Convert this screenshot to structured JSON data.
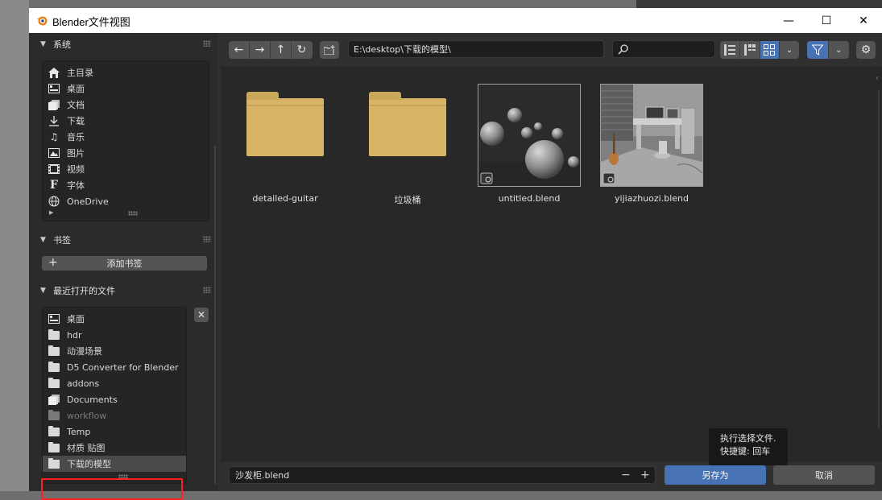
{
  "window": {
    "title": "Blender文件视图",
    "minimize_symbol": "—",
    "maximize_symbol": "☐",
    "close_symbol": "✕"
  },
  "sidebar": {
    "system": {
      "header": "系统",
      "items": [
        {
          "label": "主目录",
          "icon": "home-icon"
        },
        {
          "label": "桌面",
          "icon": "desktop-icon"
        },
        {
          "label": "文档",
          "icon": "documents-icon"
        },
        {
          "label": "下载",
          "icon": "download-icon"
        },
        {
          "label": "音乐",
          "icon": "music-icon"
        },
        {
          "label": "图片",
          "icon": "image-icon"
        },
        {
          "label": "视频",
          "icon": "video-icon"
        },
        {
          "label": "字体",
          "icon": "font-icon"
        },
        {
          "label": "OneDrive",
          "icon": "globe-icon"
        }
      ]
    },
    "bookmarks": {
      "header": "书签",
      "add_label": "添加书签"
    },
    "recent": {
      "header": "最近打开的文件",
      "items": [
        {
          "label": "桌面",
          "icon": "desktop-icon"
        },
        {
          "label": "hdr",
          "icon": "folder-icon"
        },
        {
          "label": "动漫场景",
          "icon": "folder-icon"
        },
        {
          "label": "D5 Converter for Blender",
          "icon": "folder-icon"
        },
        {
          "label": "addons",
          "icon": "folder-icon"
        },
        {
          "label": "Documents",
          "icon": "documents-icon"
        },
        {
          "label": "workflow",
          "icon": "folder-icon"
        },
        {
          "label": "Temp",
          "icon": "folder-icon"
        },
        {
          "label": "材质 贴图",
          "icon": "folder-icon"
        },
        {
          "label": "下载的模型",
          "icon": "folder-icon"
        }
      ]
    }
  },
  "toolbar": {
    "back": "←",
    "forward": "→",
    "parent": "↑",
    "refresh": "↻",
    "path": "E:\\desktop\\下载的模型\\",
    "search_value": ""
  },
  "files": [
    {
      "name": "detailed-guitar",
      "type": "folder"
    },
    {
      "name": "垃圾桶",
      "type": "folder"
    },
    {
      "name": "untitled.blend",
      "type": "blend"
    },
    {
      "name": "yijiazhuozi.blend",
      "type": "blend"
    }
  ],
  "bottom": {
    "filename": "沙发柜.blend",
    "minus": "−",
    "plus": "+",
    "save_label": "另存为",
    "cancel_label": "取消"
  },
  "tooltip": {
    "line1": "执行选择文件.",
    "line2": "快捷键: 回车"
  },
  "colors": {
    "accent": "#4772b3",
    "folder": "#d8b566",
    "highlight": "#ff2020"
  }
}
